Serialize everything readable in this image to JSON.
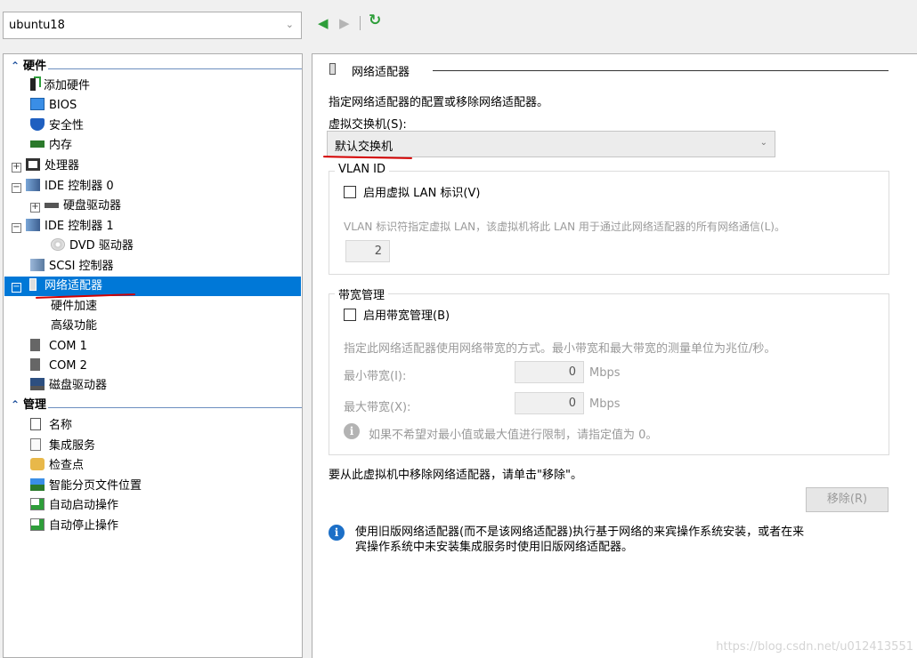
{
  "vm_selector": {
    "value": "ubuntu18"
  },
  "nav": {
    "back": "◀",
    "forward": "▶",
    "refresh": "↻"
  },
  "tree": {
    "hardware_header": "硬件",
    "management_header": "管理",
    "items": {
      "add_hardware": "添加硬件",
      "bios": "BIOS",
      "security": "安全性",
      "memory": "内存",
      "processor": "处理器",
      "ide0": "IDE 控制器 0",
      "hdd": "硬盘驱动器",
      "ide1": "IDE 控制器 1",
      "dvd": "DVD 驱动器",
      "scsi": "SCSI 控制器",
      "network_adapter": "网络适配器",
      "hw_accel": "硬件加速",
      "advanced": "高级功能",
      "com1": "COM 1",
      "com2": "COM 2",
      "floppy": "磁盘驱动器",
      "name": "名称",
      "integration": "集成服务",
      "checkpoints": "检查点",
      "smart_paging": "智能分页文件位置",
      "auto_start": "自动启动操作",
      "auto_stop": "自动停止操作"
    }
  },
  "main": {
    "section_title": "网络适配器",
    "description": "指定网络适配器的配置或移除网络适配器。",
    "switch_label": "虚拟交换机(S):",
    "switch_value": "默认交换机",
    "vlan": {
      "group_label": "VLAN ID",
      "checkbox_label": "启用虚拟 LAN 标识(V)",
      "checked": false,
      "help": "VLAN 标识符指定虚拟 LAN，该虚拟机将此 LAN 用于通过此网络适配器的所有网络通信(L)。",
      "value": "2"
    },
    "bandwidth": {
      "group_label": "带宽管理",
      "checkbox_label": "启用带宽管理(B)",
      "checked": false,
      "help": "指定此网络适配器使用网络带宽的方式。最小带宽和最大带宽的测量单位为兆位/秒。",
      "min_label": "最小带宽(I):",
      "min_value": "0",
      "max_label": "最大带宽(X):",
      "max_value": "0",
      "unit": "Mbps",
      "note": "如果不希望对最小值或最大值进行限制，请指定值为 0。"
    },
    "remove_text": "要从此虚拟机中移除网络适配器，请单击\"移除\"。",
    "remove_button": "移除(R)",
    "legacy_info_line1": "使用旧版网络适配器(而不是该网络适配器)执行基于网络的来宾操作系统安装，或者在来",
    "legacy_info_line2": "宾操作系统中未安装集成服务时使用旧版网络适配器。"
  },
  "watermark": "https://blog.csdn.net/u012413551",
  "colors": {
    "selection": "#0078d7",
    "nav_green": "#2e9e3a",
    "annotation_red": "#d40000"
  }
}
